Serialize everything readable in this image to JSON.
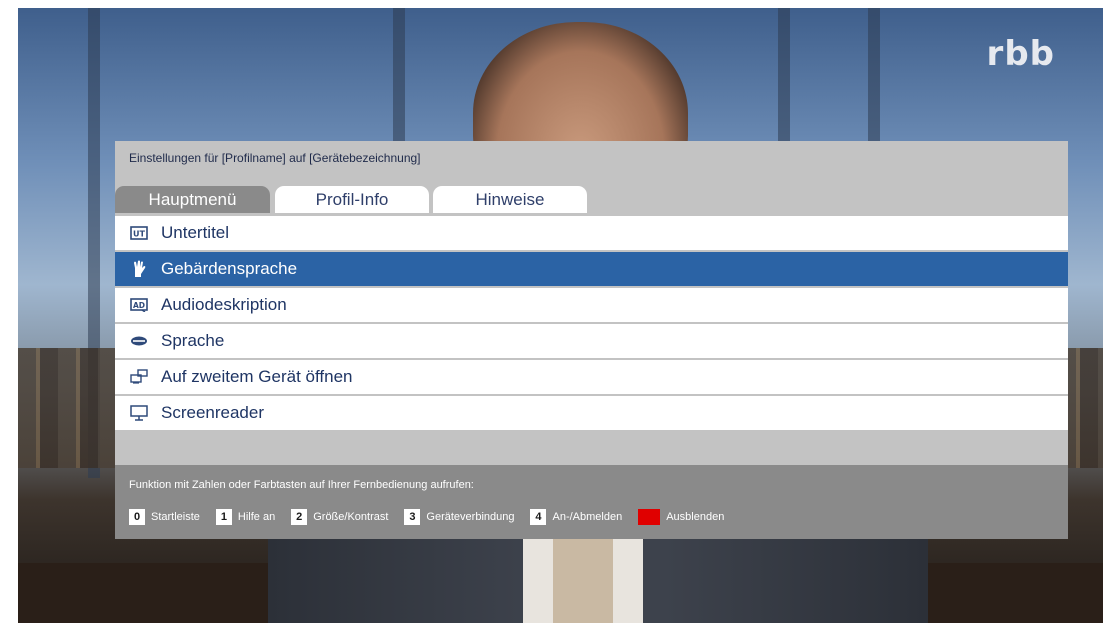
{
  "logo": "rbb",
  "panel": {
    "title": "Einstellungen für [Profilname] auf [Gerätebezeichnung]"
  },
  "tabs": [
    {
      "label": "Hauptmenü",
      "active": true
    },
    {
      "label": "Profil-Info",
      "active": false
    },
    {
      "label": "Hinweise",
      "active": false
    }
  ],
  "menu": [
    {
      "label": "Untertitel",
      "icon": "subtitle-icon",
      "selected": false
    },
    {
      "label": "Gebärdensprache",
      "icon": "sign-language-icon",
      "selected": true
    },
    {
      "label": "Audiodeskription",
      "icon": "audio-description-icon",
      "selected": false
    },
    {
      "label": "Sprache",
      "icon": "language-icon",
      "selected": false
    },
    {
      "label": "Auf zweitem Gerät öffnen",
      "icon": "second-device-icon",
      "selected": false
    },
    {
      "label": "Screenreader",
      "icon": "screenreader-icon",
      "selected": false
    }
  ],
  "footer": {
    "text": "Funktion mit Zahlen oder Farbtasten auf Ihrer Fernbedienung aufrufen:",
    "keys": [
      {
        "key": "0",
        "label": "Startleiste"
      },
      {
        "key": "1",
        "label": "Hilfe an"
      },
      {
        "key": "2",
        "label": "Größe/Kontrast"
      },
      {
        "key": "3",
        "label": "Geräteverbindung"
      },
      {
        "key": "4",
        "label": "An-/Abmelden"
      },
      {
        "key": "red",
        "label": "Ausblenden"
      }
    ]
  },
  "colors": {
    "selected": "#2b63a5",
    "panel": "#c3c3c3",
    "footer": "#8a8a8a",
    "red_key": "#e00000"
  }
}
